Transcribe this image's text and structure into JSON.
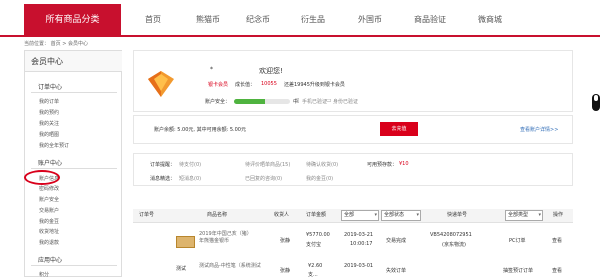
{
  "nav": {
    "category_label": "所有商品分类",
    "items": [
      "首页",
      "熊猫币",
      "纪念币",
      "衍生品",
      "外国币",
      "商品验证",
      "微商城"
    ]
  },
  "breadcrumb": {
    "prefix": "当前位置：",
    "home": "首页",
    "separator": ">",
    "current": "会员中心"
  },
  "sidebar": {
    "title": "会员中心",
    "order_center": {
      "heading": "订单中心",
      "items": [
        "我的订单",
        "我的预约",
        "我的关注",
        "我的晒图",
        "我的全年预订"
      ]
    },
    "account_center": {
      "heading": "账户中心",
      "items": [
        "账户信息",
        "密码修改",
        "账户安全",
        "交易账户",
        "我的金豆",
        "收货地址",
        "我的退款"
      ]
    },
    "app_center": {
      "heading": "应用中心",
      "items": [
        "积分"
      ]
    }
  },
  "profile": {
    "username": "*",
    "greeting": "欢迎您!",
    "member_level": "银卡会员",
    "growth_label": "成长值：",
    "growth_value": "10055",
    "upgrade_text": "还差19945升级到银卡会员",
    "security_label": "账户安全：",
    "security_level_text": "中",
    "security_progress": 0.55,
    "phone_status": "手机已验证",
    "identity_status": "身份已验证"
  },
  "balance": {
    "text": "账户余额: 5.00元, 其中可用余额: 5.00元",
    "recharge_button": "去充值",
    "details_link": "查看账户详情>>"
  },
  "stats": {
    "row1": [
      {
        "label": "订单提醒：",
        "value": "待支付(0)"
      },
      {
        "label": "",
        "value": "待评价晒单商品(15)"
      },
      {
        "label": "",
        "value": "待确认收货(0)"
      },
      {
        "label": "可用预存款：",
        "value": "¥10"
      }
    ],
    "row2": [
      {
        "label": "消息精选：",
        "value": "短消息(0)"
      },
      {
        "label": "",
        "value": "已回复的咨询(0)"
      },
      {
        "label": "",
        "value": "我的金豆(0)"
      }
    ]
  },
  "table": {
    "headers": [
      "订单号",
      "商品名称",
      "收货人",
      "订单金额",
      "全部",
      "全部状态",
      "快递单号",
      "全部类型",
      "操作"
    ],
    "rows": [
      {
        "product": "2019年中国己亥（猪）年熊猫金银币",
        "receiver": "张静",
        "amount": "¥5770.00",
        "payment": "支付宝",
        "time": "2019-03-21",
        "time2": "10:00:17",
        "status": "交易完成",
        "tracking": "VB54208072951",
        "courier": "(京东物流)",
        "type": "PC订单",
        "action": "查看"
      },
      {
        "product": "测试商品-中性笔（系统测试",
        "product_prefix": "测试",
        "receiver": "张静",
        "amount": "¥2.60",
        "payment": "支...",
        "time": "2019-03-01",
        "time2": "",
        "status": "失效订单",
        "tracking": "",
        "courier": "",
        "type": "抽签预订订单",
        "action": "查看"
      }
    ]
  }
}
